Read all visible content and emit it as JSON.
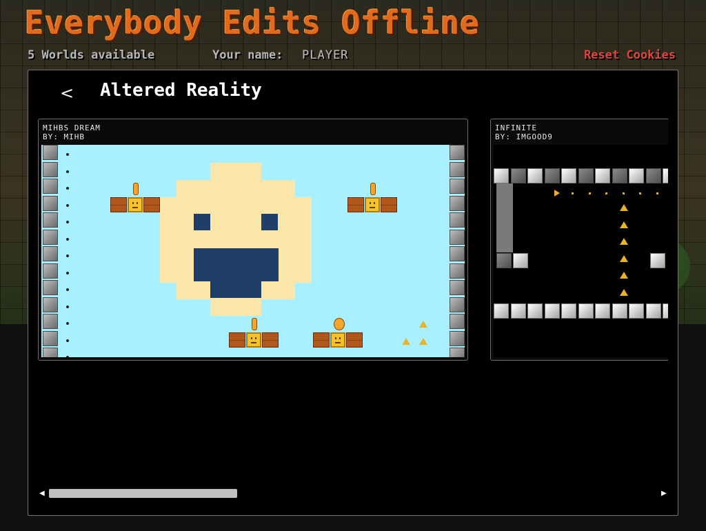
{
  "app": {
    "title": "Everybody Edits Offline",
    "worlds_count": "5 Worlds available",
    "name_label": "Your name:",
    "name_value": "PLAYER",
    "reset_label": "Reset Cookies"
  },
  "panel": {
    "back_icon": "chevron-left-icon",
    "back_glyph": "<",
    "title": "Altered Reality"
  },
  "worlds": [
    {
      "name": "MIHBS DREAM",
      "author": "BY: MIHB"
    },
    {
      "name": "INFINITE",
      "author": "BY: IMGOOD9"
    }
  ],
  "scrollbar": {
    "left_glyph": "◀",
    "right_glyph": "▶",
    "thumb_fraction": 0.31
  },
  "colors": {
    "title": "#e06a1e",
    "reset_link": "#e0443e",
    "sky": "#a8efff"
  }
}
